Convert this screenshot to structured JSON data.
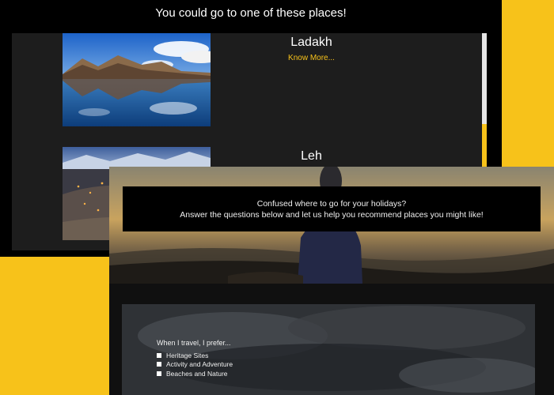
{
  "results": {
    "title": "You could go to one of these places!",
    "places": [
      {
        "name": "Ladakh",
        "link_label": "Know More..."
      },
      {
        "name": "Leh"
      }
    ]
  },
  "quiz": {
    "banner_line1": "Confused where to go for your holidays?",
    "banner_line2": "Answer the questions below and let us help you recommend places you might like!",
    "question": "When I travel, I prefer...",
    "options": [
      "Heritage Sites",
      "Activity and Adventure",
      "Beaches and Nature"
    ]
  },
  "colors": {
    "accent": "#f7c21a",
    "background": "#000000",
    "panel": "#1d1d1d"
  }
}
